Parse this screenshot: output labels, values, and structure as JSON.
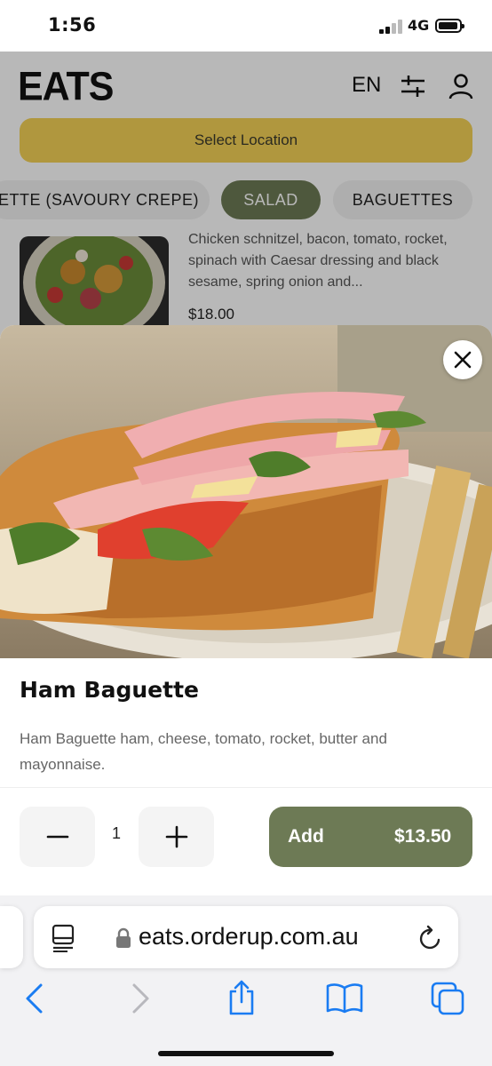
{
  "status_bar": {
    "time": "1:56",
    "network": "4G"
  },
  "header": {
    "logo": "EATS",
    "language": "EN",
    "icons": [
      "filters-icon",
      "user-icon"
    ]
  },
  "location_button": "Select Location",
  "categories": [
    {
      "label": "ETTE (SAVOURY CREPE)",
      "active": false
    },
    {
      "label": "SALAD",
      "active": true
    },
    {
      "label": "BAGUETTES",
      "active": false
    }
  ],
  "menu_item": {
    "description": "Chicken schnitzel, bacon, tomato, rocket, spinach with Caesar dressing and black sesame, spring onion and...",
    "price": "$18.00"
  },
  "modal": {
    "title": "Ham Baguette",
    "description": "Ham Baguette ham, cheese, tomato, rocket, butter and mayonnaise.",
    "quantity": "1",
    "add_label": "Add",
    "add_price": "$13.50"
  },
  "browser": {
    "url": "eats.orderup.com.au"
  },
  "colors": {
    "accent_green": "#6d7a55",
    "location_yellow": "#f4d257",
    "link_blue": "#1a7cf2"
  }
}
